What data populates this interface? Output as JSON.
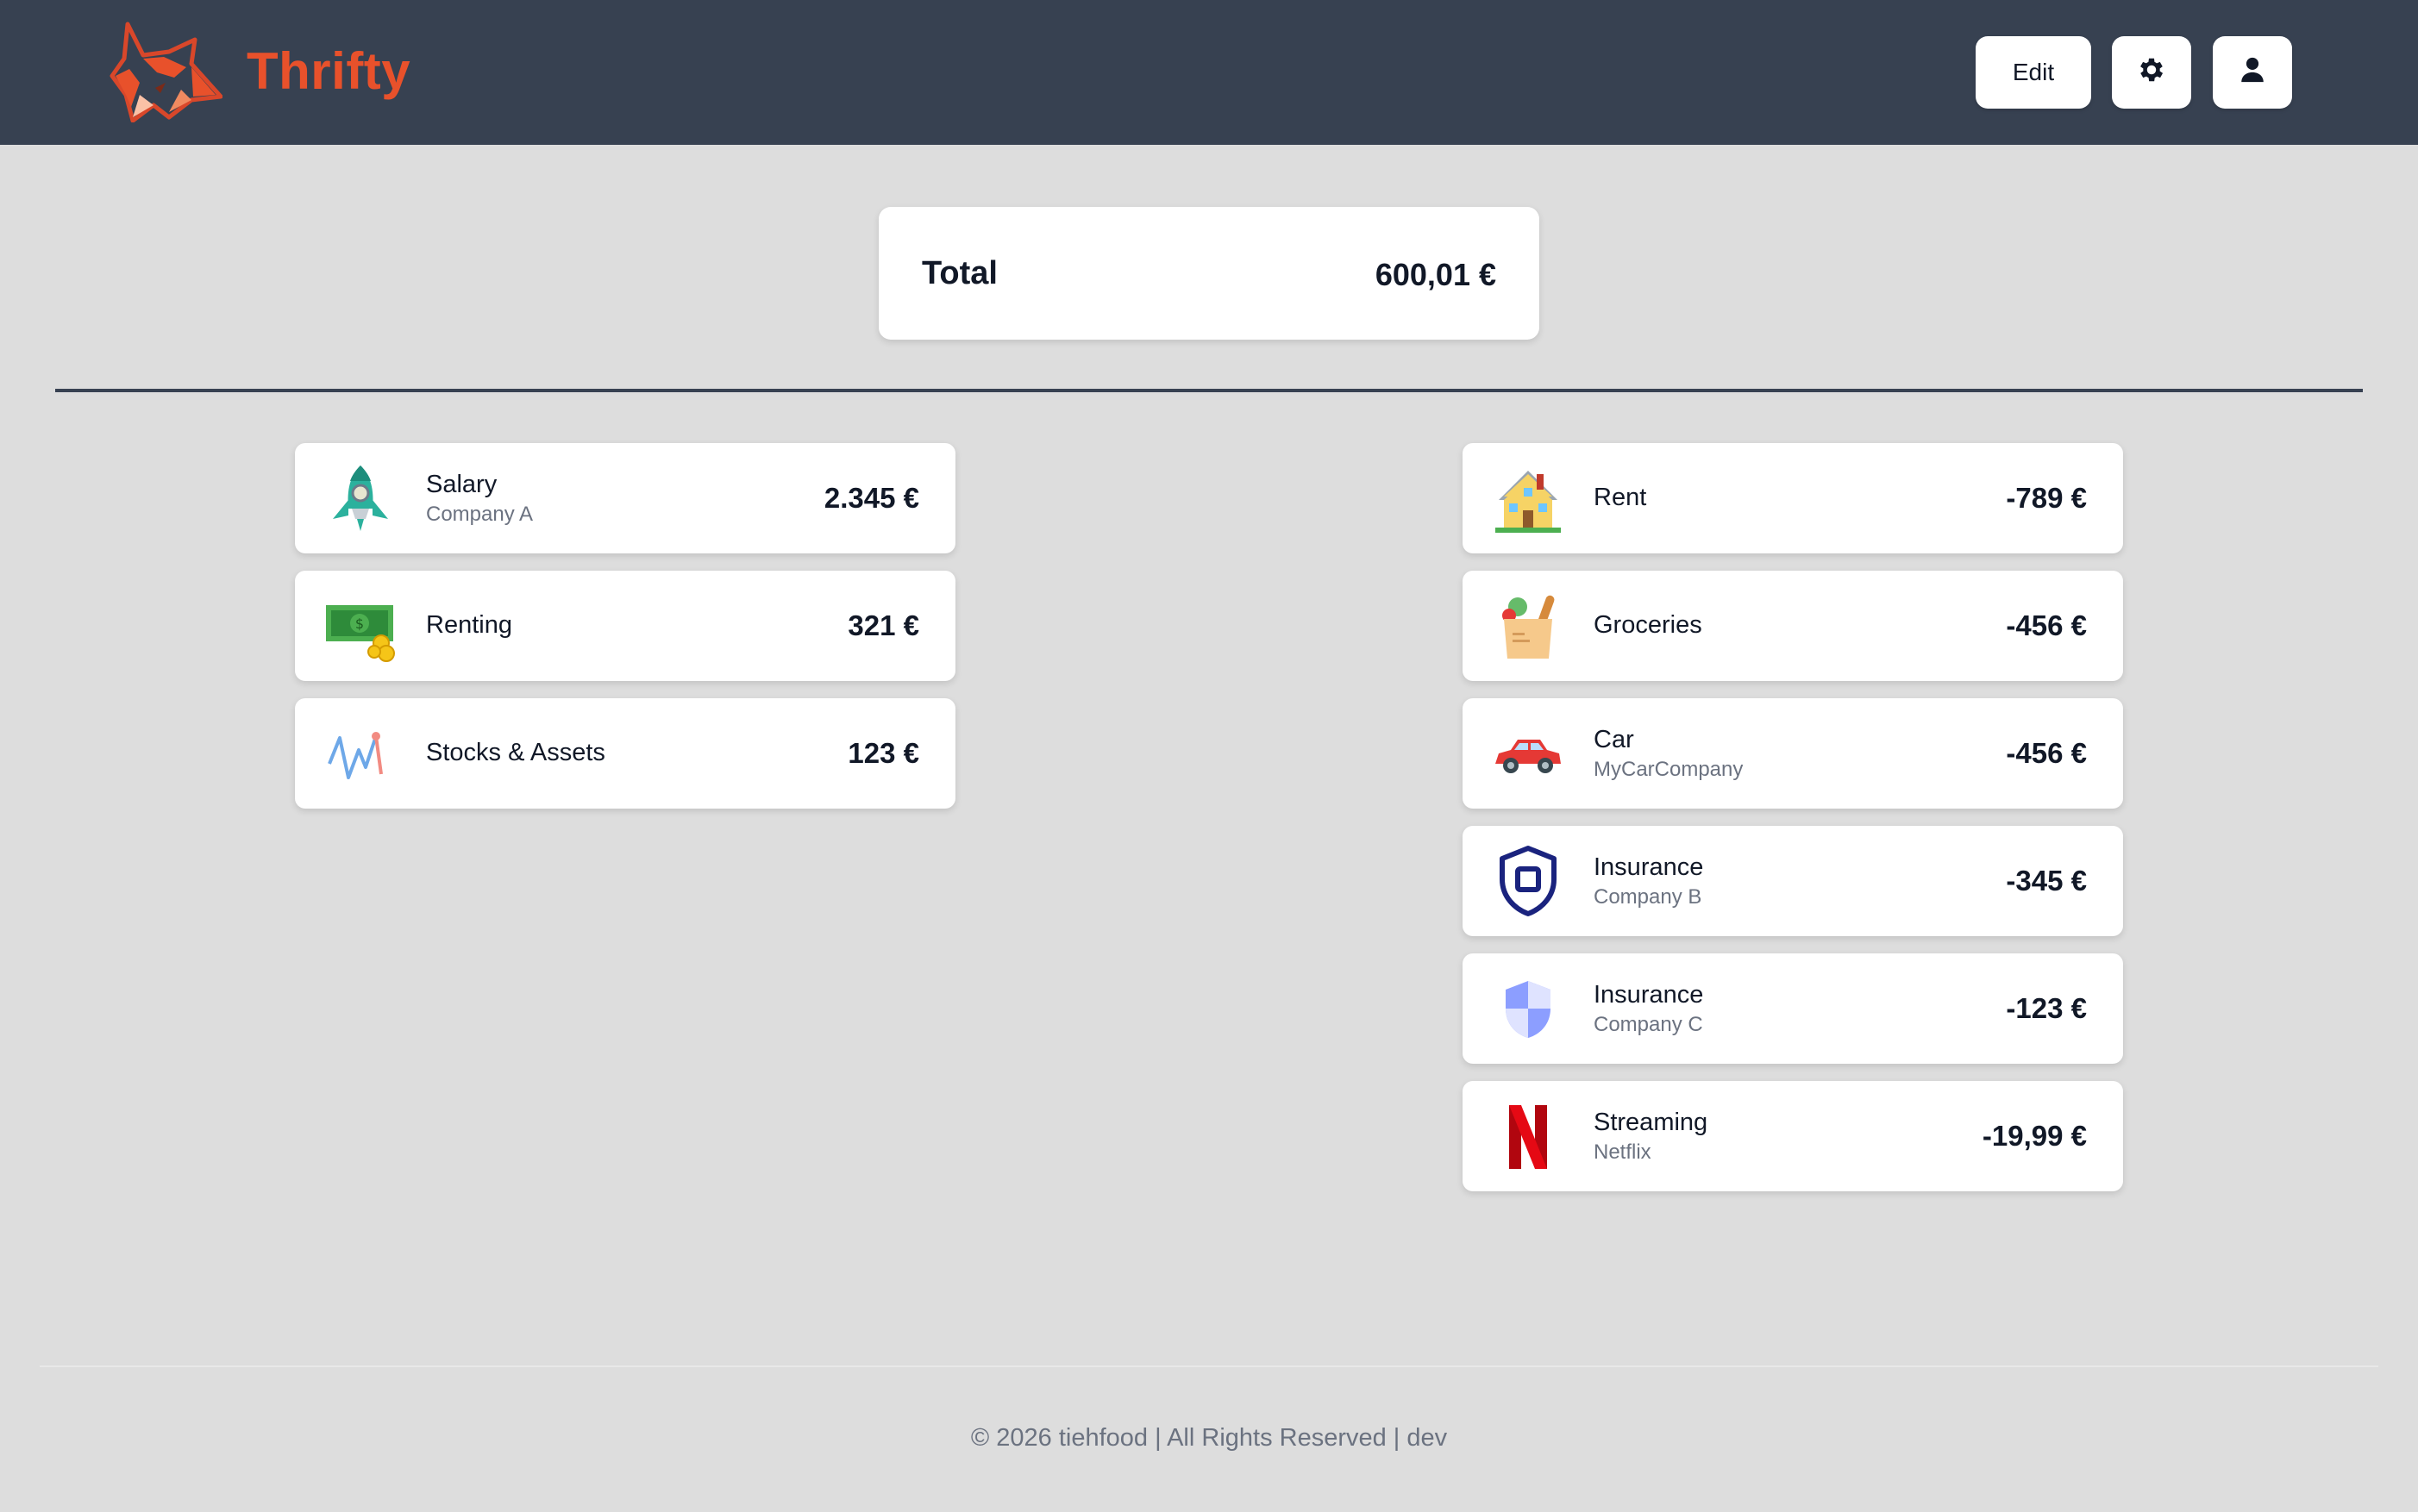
{
  "app": {
    "name": "Thrifty",
    "logo_icon": "fox-logo-icon",
    "brand_color": "#e8512b"
  },
  "header": {
    "edit_label": "Edit",
    "settings_icon": "gear-icon",
    "profile_icon": "user-icon",
    "background": "#374151"
  },
  "summary": {
    "total_label": "Total",
    "total_value": "600,01 €"
  },
  "income": [
    {
      "name": "Salary",
      "sub": "Company A",
      "amount": "2.345 €",
      "icon": "rocket-icon"
    },
    {
      "name": "Renting",
      "sub": "",
      "amount": "321 €",
      "icon": "money-bill-icon"
    },
    {
      "name": "Stocks & Assets",
      "sub": "",
      "amount": "123 €",
      "icon": "stock-chart-icon"
    }
  ],
  "expenses": [
    {
      "name": "Rent",
      "sub": "",
      "amount": "-789 €",
      "icon": "house-icon"
    },
    {
      "name": "Groceries",
      "sub": "",
      "amount": "-456 €",
      "icon": "grocery-bag-icon"
    },
    {
      "name": "Car",
      "sub": "MyCarCompany",
      "amount": "-456 €",
      "icon": "car-icon"
    },
    {
      "name": "Insurance",
      "sub": "Company B",
      "amount": "-345 €",
      "icon": "shield-outline-icon"
    },
    {
      "name": "Insurance",
      "sub": "Company C",
      "amount": "-123 €",
      "icon": "shield-icon"
    },
    {
      "name": "Streaming",
      "sub": "Netflix",
      "amount": "-19,99 €",
      "icon": "netflix-icon"
    }
  ],
  "footer": {
    "text": "© 2026 tiehfood | All Rights Reserved | dev"
  }
}
